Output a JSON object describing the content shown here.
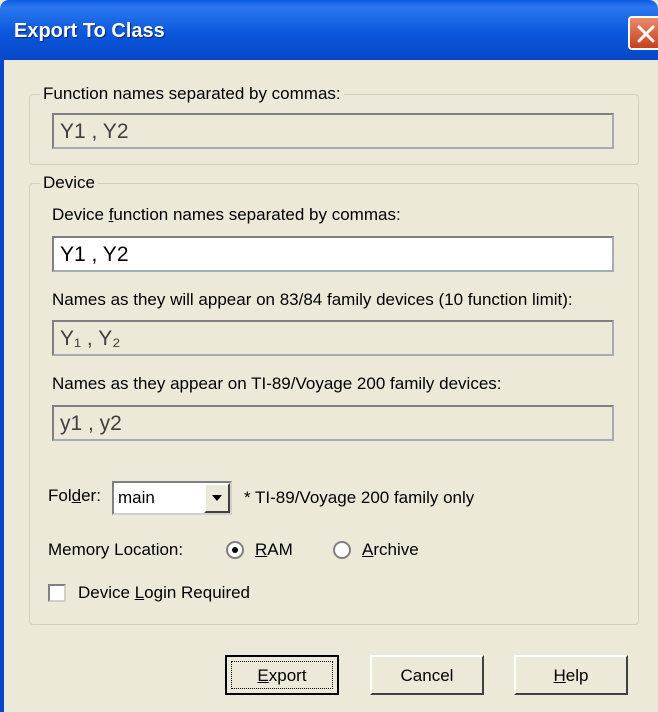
{
  "window": {
    "title": "Export To Class",
    "close_icon": "close-icon"
  },
  "function_names": {
    "legend": "Function names separated by commas:",
    "value": "Y1 , Y2"
  },
  "device": {
    "legend": "Device",
    "function_names_label_pre": "Device ",
    "function_names_label_ul": "f",
    "function_names_label_post": "unction names separated by commas:",
    "function_names_value": "Y1 , Y2",
    "ti83_label": "Names as they will appear on 83/84 family devices (10 function limit):",
    "ti83_value": "Y₁ , Y₂",
    "ti89_label": "Names as they appear on TI-89/Voyage 200 family devices:",
    "ti89_value": "y1 , y2",
    "folder_label_pre": "Fol",
    "folder_label_ul": "d",
    "folder_label_post": "er:",
    "folder_value": "main",
    "folder_note": "* TI-89/Voyage 200 family only",
    "memory_label": "Memory Location:",
    "memory_options": [
      {
        "ul": "R",
        "rest": "AM",
        "selected": true
      },
      {
        "ul": "A",
        "rest": "rchive",
        "selected": false
      }
    ],
    "login_label_pre": "Device ",
    "login_label_ul": "L",
    "login_label_post": "ogin Required",
    "login_checked": false
  },
  "buttons": {
    "export": {
      "ul": "E",
      "rest": "xport"
    },
    "cancel": {
      "label": "Cancel"
    },
    "help": {
      "ul": "H",
      "rest": "elp"
    }
  }
}
